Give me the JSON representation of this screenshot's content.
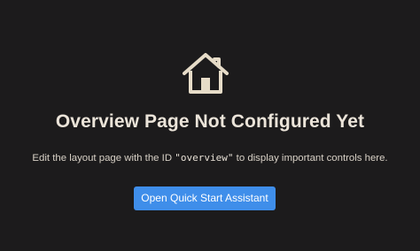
{
  "empty_state": {
    "icon": "home-icon",
    "title": "Overview Page Not Configured Yet",
    "description_before": "Edit the layout page with the ID ",
    "description_code": "\"overview\"",
    "description_after": " to display important controls here.",
    "button_label": "Open Quick Start Assistant"
  },
  "colors": {
    "background": "#1c1b1c",
    "text": "#ebe4d9",
    "button": "#3f8eea",
    "button_text": "#ffffff"
  }
}
